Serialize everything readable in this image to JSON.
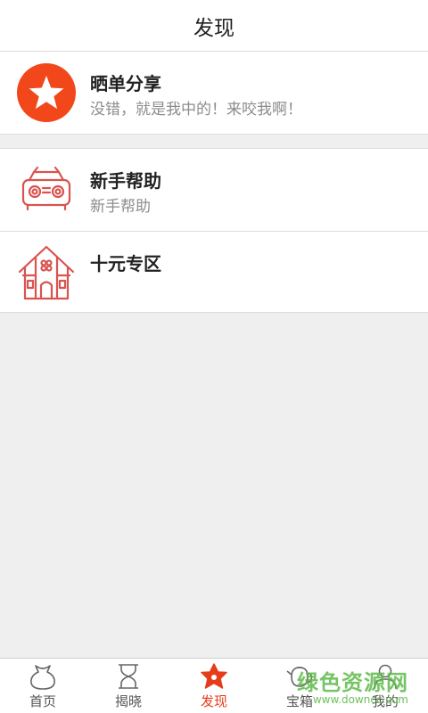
{
  "header": {
    "title": "发现"
  },
  "sections": [
    {
      "items": [
        {
          "icon": "star-icon",
          "title": "晒单分享",
          "subtitle": "没错，就是我中的！来咬我啊！"
        }
      ]
    },
    {
      "items": [
        {
          "icon": "car-icon",
          "title": "新手帮助",
          "subtitle": "新手帮助"
        },
        {
          "icon": "house-icon",
          "title": "十元专区"
        }
      ]
    }
  ],
  "tabs": [
    {
      "label": "首页",
      "icon": "bag-icon",
      "active": false
    },
    {
      "label": "揭晓",
      "icon": "hourglass-icon",
      "active": false
    },
    {
      "label": "发现",
      "icon": "star-badge-icon",
      "active": true
    },
    {
      "label": "宝箱",
      "icon": "teapot-icon",
      "active": false
    },
    {
      "label": "我的",
      "icon": "person-icon",
      "active": false
    }
  ],
  "watermark": {
    "main": "绿色资源网",
    "sub": "www.downcc.com"
  },
  "colors": {
    "accent": "#e53c1a",
    "icon_line": "#d9534f",
    "background": "#efefef"
  }
}
